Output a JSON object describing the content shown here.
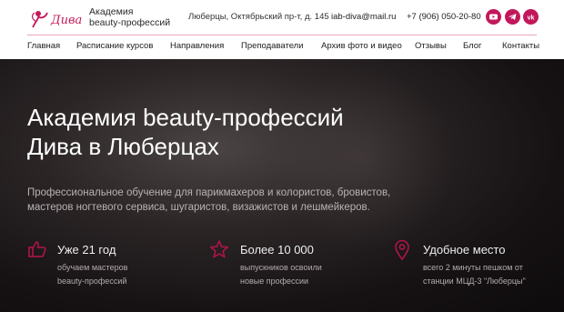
{
  "header": {
    "logo_text": "Дива",
    "brand_line1": "Академия",
    "brand_line2": "beauty-профессий",
    "address": "Люберцы, Октябрьский пр-т, д. 145",
    "email": "iab-diva@mail.ru",
    "phone": "+7 (906) 050-20-80",
    "socials": [
      "youtube-icon",
      "telegram-icon",
      "vk-icon"
    ]
  },
  "nav": {
    "items": [
      "Главная",
      "Расписание курсов",
      "Направления",
      "Преподаватели",
      "Архив фото и видео",
      "Отзывы",
      "Блог",
      "Контакты"
    ]
  },
  "hero": {
    "title_line1": "Академия beauty-профессий",
    "title_line2": "Дива в Люберцах",
    "lead": "Профессиональное обучение для парикмахеров и колористов, бровистов, мастеров ногтевого сервиса, шугаристов, визажистов и лешмейкеров.",
    "features": [
      {
        "icon": "thumbs-up-icon",
        "title": "Уже 21 год",
        "line1": "обучаем мастеров",
        "line2": "beauty-профессий"
      },
      {
        "icon": "star-icon",
        "title": "Более 10 000",
        "line1": "выпускников освоили",
        "line2": "новые профессии"
      },
      {
        "icon": "location-pin-icon",
        "title": "Удобное место",
        "line1": "всего 2 минуты пешком от",
        "line2": "станции МЦД-3 \"Люберцы\""
      }
    ]
  },
  "colors": {
    "accent": "#c2185b",
    "hero_bg": "#1a1516",
    "icon": "#b01449"
  }
}
